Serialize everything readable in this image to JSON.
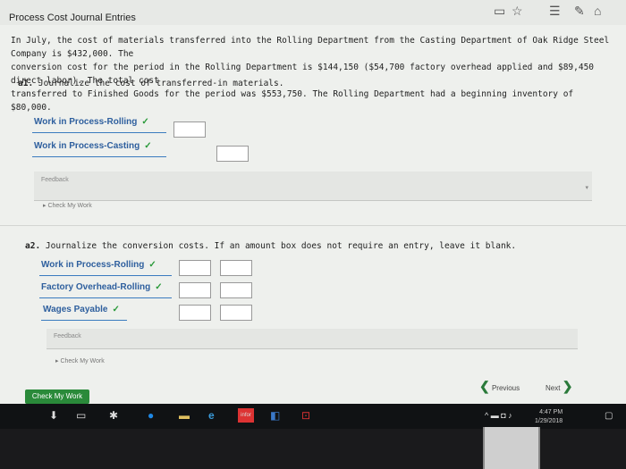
{
  "page_title": "Process Cost Journal Entries",
  "intro_lines": [
    "In July, the cost of materials transferred into the Rolling Department from the Casting Department of Oak Ridge Steel Company is $432,000. The",
    "conversion cost for the period in the Rolling Department is $144,150 ($54,700 factory overhead applied and $89,450 direct labor). The total cost",
    "transferred to Finished Goods for the period was $553,750. The Rolling Department had a beginning inventory of $80,000."
  ],
  "a1": {
    "label_num": "a1.",
    "label_text": "Journalize the cost of transferred-in materials.",
    "rows": [
      {
        "account": "Work in Process-Rolling"
      },
      {
        "account": "Work in Process-Casting"
      }
    ],
    "feedback": "Feedback",
    "check_my_work": "Check My Work"
  },
  "a2": {
    "label_num": "a2.",
    "label_text": "Journalize the conversion costs. If an amount box does not require an entry, leave it blank.",
    "rows": [
      {
        "account": "Work in Process-Rolling"
      },
      {
        "account": "Factory Overhead-Rolling"
      },
      {
        "account": "Wages Payable"
      }
    ],
    "feedback": "Feedback",
    "check_my_work": "Check My Work"
  },
  "check_mark": "✓",
  "footer": {
    "check_my_work_button": "Check My Work",
    "previous": "Previous",
    "next": "Next"
  },
  "clock": {
    "time": "4:47 PM",
    "date": "1/29/2018"
  },
  "colors": {
    "accent_green": "#2a8a3a",
    "link_blue": "#2e5f9e"
  }
}
